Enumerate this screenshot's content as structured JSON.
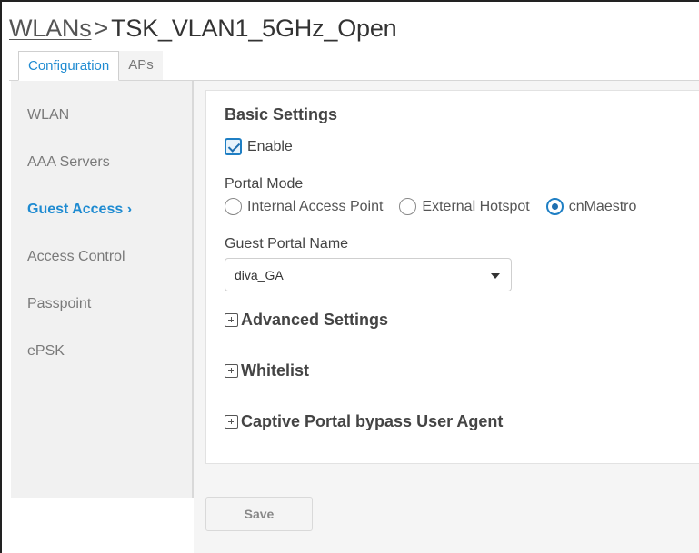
{
  "header": {
    "breadcrumb_link": "WLANs",
    "separator": ">",
    "page_title": "TSK_VLAN1_5GHz_Open"
  },
  "tabs": [
    {
      "label": "Configuration",
      "active": true
    },
    {
      "label": "APs",
      "active": false
    }
  ],
  "sidebar": {
    "items": [
      {
        "label": "WLAN",
        "active": false
      },
      {
        "label": "AAA Servers",
        "active": false
      },
      {
        "label": "Guest Access ›",
        "active": true
      },
      {
        "label": "Access Control",
        "active": false
      },
      {
        "label": "Passpoint",
        "active": false
      },
      {
        "label": "ePSK",
        "active": false
      }
    ]
  },
  "main": {
    "section_title": "Basic Settings",
    "enable": {
      "label": "Enable",
      "checked": true
    },
    "portal_mode": {
      "label": "Portal Mode",
      "options": [
        {
          "label": "Internal Access Point",
          "selected": false
        },
        {
          "label": "External Hotspot",
          "selected": false
        },
        {
          "label": "cnMaestro",
          "selected": true
        }
      ]
    },
    "guest_portal": {
      "label": "Guest Portal Name",
      "value": "diva_GA"
    },
    "expanders": [
      {
        "label": "Advanced Settings"
      },
      {
        "label": "Whitelist"
      },
      {
        "label": "Captive Portal bypass User Agent"
      }
    ]
  },
  "footer": {
    "save_label": "Save"
  },
  "colors": {
    "accent": "#1f8bd1",
    "sidebar_bg": "#f1f1f1",
    "text": "#444444"
  }
}
